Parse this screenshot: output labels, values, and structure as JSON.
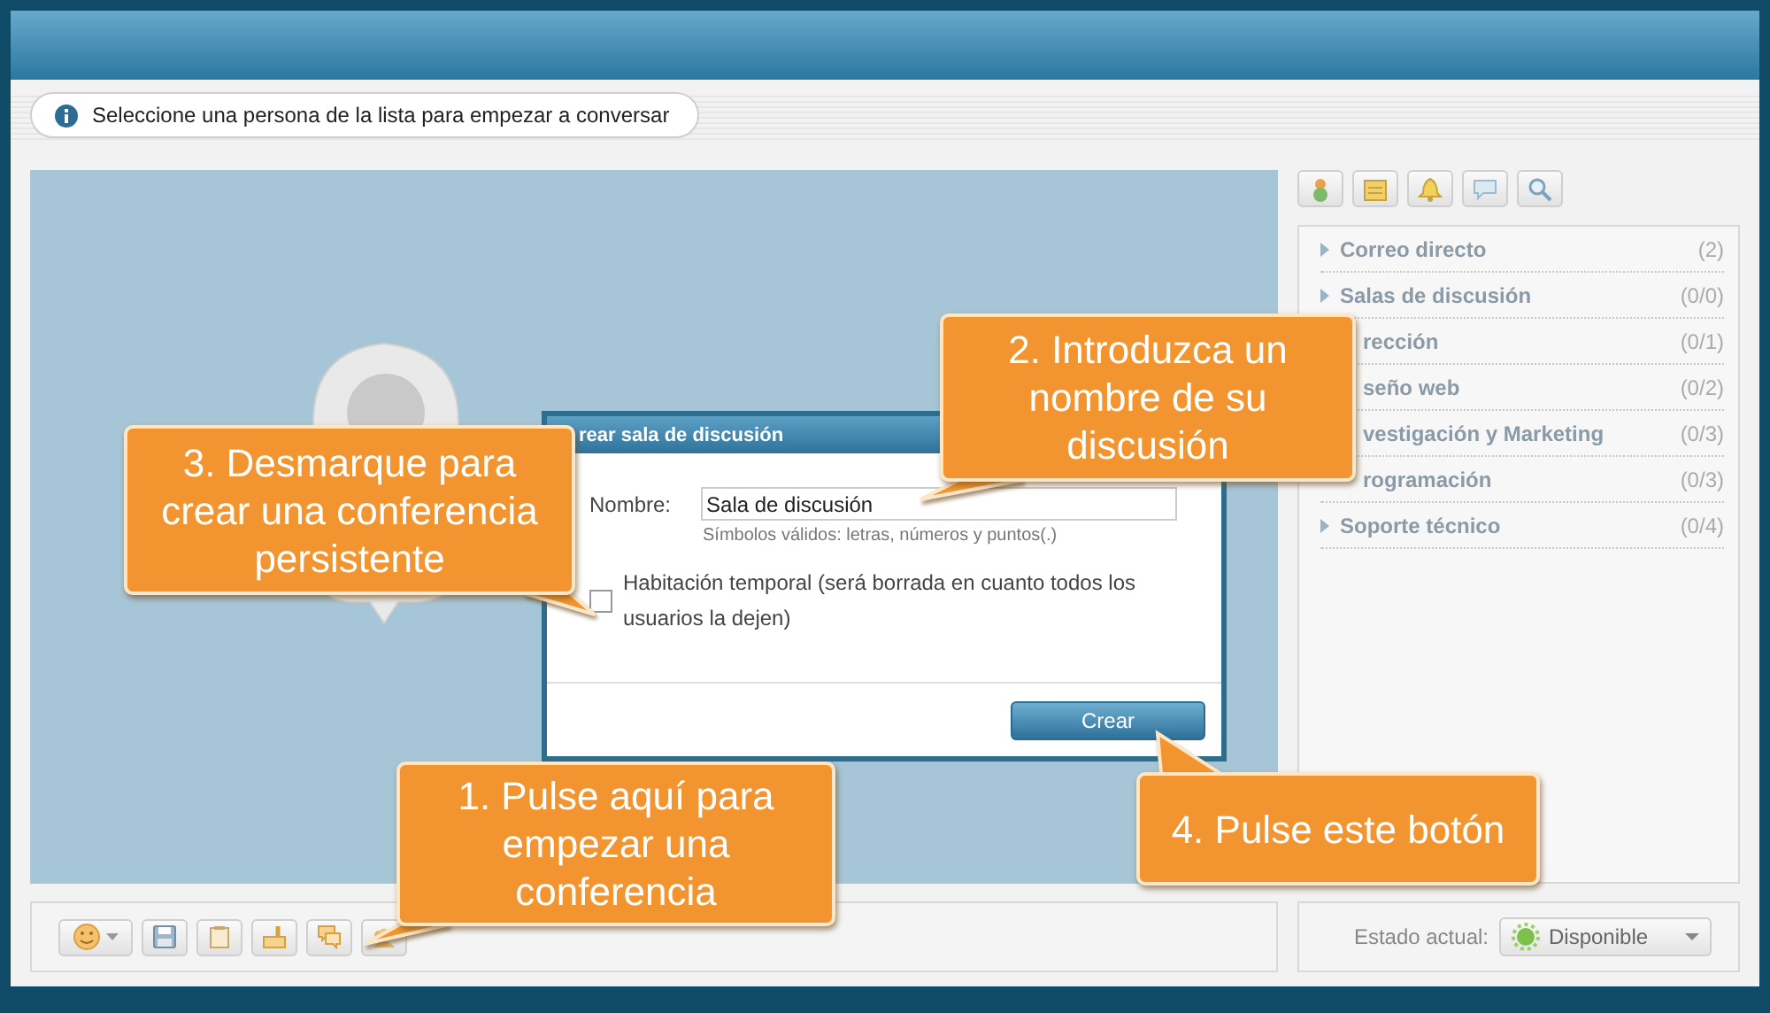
{
  "info_bar": {
    "text": "Seleccione una persona de la lista para empezar a conversar"
  },
  "dialog": {
    "title": "rear sala de discusión",
    "name_label": "Nombre:",
    "name_value": "Sala de discusión",
    "hint": "Símbolos válidos: letras, números y puntos(.)",
    "temporary_room": {
      "label": "Habitación temporal (será borrada en cuanto todos los usuarios la dejen)",
      "checked": false
    },
    "button": "Crear"
  },
  "groups": [
    {
      "label": "Correo directo",
      "count": "(2)",
      "partial": false
    },
    {
      "label": "Salas de discusión",
      "count": "(0/0)",
      "partial": false
    },
    {
      "label": "rección",
      "count": "(0/1)",
      "partial": true
    },
    {
      "label": "seño web",
      "count": "(0/2)",
      "partial": true
    },
    {
      "label": "vestigación y Marketing",
      "count": "(0/3)",
      "partial": true
    },
    {
      "label": "rogramación",
      "count": "(0/3)",
      "partial": true
    },
    {
      "label": "Soporte técnico",
      "count": "(0/4)",
      "partial": false
    }
  ],
  "status": {
    "label": "Estado actual:",
    "value": "Disponible"
  },
  "callouts": [
    {
      "text": "1. Pulse aquí para empezar una conferencia"
    },
    {
      "text": "2. Introduzca un nombre de su discusión"
    },
    {
      "text": "3. Desmarque para crear una conferencia persistente"
    },
    {
      "text": "4. Pulse este botón"
    }
  ]
}
